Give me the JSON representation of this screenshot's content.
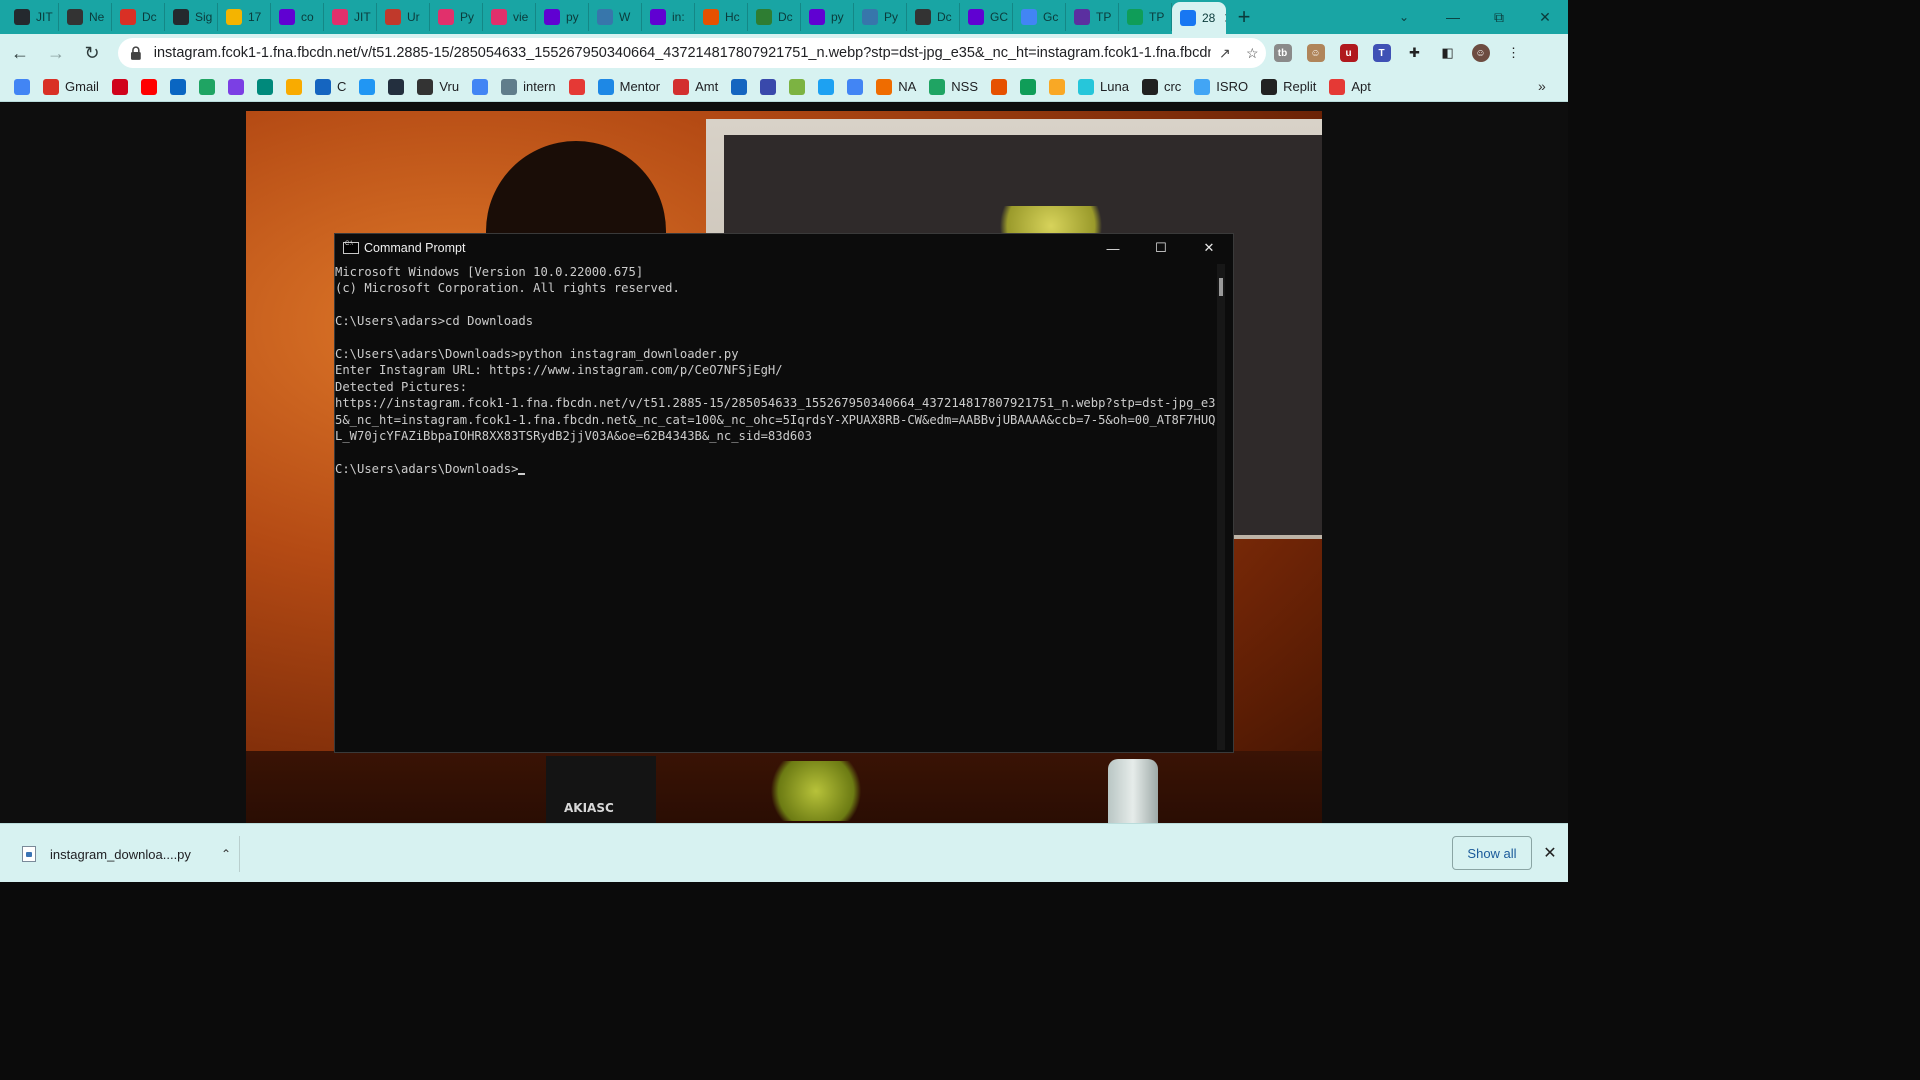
{
  "browser": {
    "tabs": [
      {
        "label": "JIT",
        "icon": "github-icon",
        "color": "#24292e"
      },
      {
        "label": "Ne",
        "icon": "globe-icon",
        "color": "#333333"
      },
      {
        "label": "Dc",
        "icon": "gmail-icon",
        "color": "#d93025"
      },
      {
        "label": "Sig",
        "icon": "github-icon",
        "color": "#24292e"
      },
      {
        "label": "17",
        "icon": "notebook-icon",
        "color": "#f4b400"
      },
      {
        "label": "co",
        "icon": "yahoo-icon",
        "color": "#6001d2"
      },
      {
        "label": "JIT",
        "icon": "instagram-icon",
        "color": "#e1306c"
      },
      {
        "label": "Ur",
        "icon": "link-icon",
        "color": "#c0392b"
      },
      {
        "label": "Py",
        "icon": "instagram-icon",
        "color": "#e1306c"
      },
      {
        "label": "vie",
        "icon": "instagram-icon",
        "color": "#e1306c"
      },
      {
        "label": "py",
        "icon": "yahoo-icon",
        "color": "#6001d2"
      },
      {
        "label": "W",
        "icon": "python-icon",
        "color": "#3776ab"
      },
      {
        "label": "in:",
        "icon": "yahoo-icon",
        "color": "#6001d2"
      },
      {
        "label": "Hc",
        "icon": "circle-icon",
        "color": "#e65100"
      },
      {
        "label": "Dc",
        "icon": "infinity-icon",
        "color": "#2e7d32"
      },
      {
        "label": "py",
        "icon": "yahoo-icon",
        "color": "#6001d2"
      },
      {
        "label": "Py",
        "icon": "python-icon",
        "color": "#3776ab"
      },
      {
        "label": "Dc",
        "icon": "download-icon",
        "color": "#333333"
      },
      {
        "label": "GC",
        "icon": "yahoo-icon",
        "color": "#6001d2"
      },
      {
        "label": "Gc",
        "icon": "google-icon",
        "color": "#4285f4"
      },
      {
        "label": "TP",
        "icon": "list-icon",
        "color": "#5b2fa0"
      },
      {
        "label": "TP",
        "icon": "plus-square-icon",
        "color": "#0f9d58"
      },
      {
        "label": "28",
        "icon": "facebook-icon",
        "color": "#1877f2",
        "active": true
      }
    ],
    "url": "instagram.fcok1-1.fna.fbcdn.net/v/t51.2885-15/285054633_155267950340664_437214817807921751_n.webp?stp=dst-jpg_e35&_nc_ht=instagram.fcok1-1.fna.fbcdn.net&...",
    "bookmarks": [
      {
        "label": "",
        "icon": "google-icon",
        "color": "#4285f4"
      },
      {
        "label": "Gmail",
        "icon": "gmail-icon",
        "color": "#d93025"
      },
      {
        "label": "",
        "icon": "d-icon",
        "color": "#d0021b"
      },
      {
        "label": "",
        "icon": "youtube-icon",
        "color": "#ff0000"
      },
      {
        "label": "",
        "icon": "linkedin-icon",
        "color": "#0a66c2"
      },
      {
        "label": "",
        "icon": "drive-icon",
        "color": "#1fa463"
      },
      {
        "label": "",
        "icon": "u-icon",
        "color": "#7b3fe4"
      },
      {
        "label": "",
        "icon": "meet-icon",
        "color": "#00897b"
      },
      {
        "label": "",
        "icon": "gallery-icon",
        "color": "#f9ab00"
      },
      {
        "label": "C",
        "icon": "c-icon",
        "color": "#1565c0"
      },
      {
        "label": "",
        "icon": "is-icon",
        "color": "#2196f3"
      },
      {
        "label": "",
        "icon": "amazon-icon",
        "color": "#232f3e"
      },
      {
        "label": "Vru",
        "icon": "flag-icon",
        "color": "#333333"
      },
      {
        "label": "",
        "icon": "google-icon",
        "color": "#4285f4"
      },
      {
        "label": "intern",
        "icon": "intern-icon",
        "color": "#607d8b"
      },
      {
        "label": "",
        "icon": "java-icon",
        "color": "#e53935"
      },
      {
        "label": "Mentor",
        "icon": "cloud-icon",
        "color": "#1e88e5"
      },
      {
        "label": "Amt",
        "icon": "amt-icon",
        "color": "#d32f2f"
      },
      {
        "label": "",
        "icon": "ring-icon",
        "color": "#1565c0"
      },
      {
        "label": "",
        "icon": "at-icon",
        "color": "#3949ab"
      },
      {
        "label": "",
        "icon": "leaf-icon",
        "color": "#7cb342"
      },
      {
        "label": "",
        "icon": "twitter-icon",
        "color": "#1da1f2"
      },
      {
        "label": "",
        "icon": "calendar-icon",
        "color": "#4285f4"
      },
      {
        "label": "NA",
        "icon": "ge-icon",
        "color": "#ef6c00"
      },
      {
        "label": "NSS",
        "icon": "drive-icon",
        "color": "#1fa463"
      },
      {
        "label": "",
        "icon": "ds-icon",
        "color": "#e65100"
      },
      {
        "label": "",
        "icon": "sheet-icon",
        "color": "#0f9d58"
      },
      {
        "label": "",
        "icon": "graduation-icon",
        "color": "#f9a825"
      },
      {
        "label": "Luna",
        "icon": "luna-icon",
        "color": "#26c6da"
      },
      {
        "label": "crc",
        "icon": "crc-icon",
        "color": "#212121"
      },
      {
        "label": "ISRO",
        "icon": "isro-icon",
        "color": "#42a5f5"
      },
      {
        "label": "Replit",
        "icon": "replit-icon",
        "color": "#222222"
      },
      {
        "label": "Apt",
        "icon": "apt-icon",
        "color": "#e53935"
      }
    ]
  },
  "cmd": {
    "title": "Command Prompt",
    "lines": [
      "Microsoft Windows [Version 10.0.22000.675]",
      "(c) Microsoft Corporation. All rights reserved.",
      "",
      "C:\\Users\\adars>cd Downloads",
      "",
      "C:\\Users\\adars\\Downloads>python instagram_downloader.py",
      "Enter Instagram URL: https://www.instagram.com/p/CeO7NFSjEgH/",
      "Detected Pictures:",
      "https://instagram.fcok1-1.fna.fbcdn.net/v/t51.2885-15/285054633_155267950340664_437214817807921751_n.webp?stp=dst-jpg_e3",
      "5&_nc_ht=instagram.fcok1-1.fna.fbcdn.net&_nc_cat=100&_nc_ohc=5IqrdsY-XPUAX8RB-CW&edm=AABBvjUBAAAA&ccb=7-5&oh=00_AT8F7HUQ",
      "L_W70jcYFAZiBbpaIOHR8XX83TSRydB2jjV03A&oe=62B4343B&_nc_sid=83d603",
      ""
    ],
    "prompt": "C:\\Users\\adars\\Downloads>"
  },
  "photo": {
    "bag_text": "AKIASC"
  },
  "downloads": {
    "file_name": "instagram_downloa....py",
    "show_all": "Show all"
  }
}
